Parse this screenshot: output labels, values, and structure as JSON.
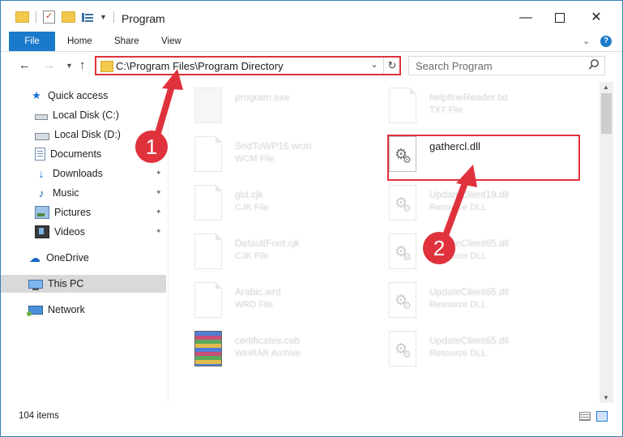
{
  "window": {
    "title": "Program",
    "controls": {
      "minimize": "—",
      "maximize": "",
      "close": "✕"
    }
  },
  "ribbon": {
    "tabs": [
      "File",
      "Home",
      "Share",
      "View"
    ]
  },
  "navigation": {
    "address": "C:\\Program Files\\Program Directory",
    "search_placeholder": "Search Program"
  },
  "nav_pane": {
    "items": [
      {
        "label": "Quick access",
        "icon": "star-icon"
      },
      {
        "label": "Local Disk (C:)",
        "icon": "drive-icon"
      },
      {
        "label": "Local Disk (D:)",
        "icon": "drive-icon"
      },
      {
        "label": "Documents",
        "icon": "documents-icon"
      },
      {
        "label": "Downloads",
        "icon": "download-icon",
        "pinned": true
      },
      {
        "label": "Music",
        "icon": "music-icon",
        "pinned": true
      },
      {
        "label": "Pictures",
        "icon": "pictures-icon",
        "pinned": true
      },
      {
        "label": "Videos",
        "icon": "videos-icon",
        "pinned": true
      },
      {
        "label": "OneDrive",
        "icon": "cloud-icon"
      },
      {
        "label": "This PC",
        "icon": "computer-icon",
        "selected": true
      },
      {
        "label": "Network",
        "icon": "network-icon"
      }
    ]
  },
  "files": {
    "left": [
      {
        "name": "program.exe",
        "type": ""
      },
      {
        "name": "SndToWP16.wcm",
        "type": "WCM File"
      },
      {
        "name": "gtd.cjk",
        "type": "CJK File"
      },
      {
        "name": "DefaultFont.cjk",
        "type": "CJK File"
      },
      {
        "name": "Arabic.wrd",
        "type": "WRD File"
      },
      {
        "name": "certificates.cab",
        "type": "WinRAR Archive"
      }
    ],
    "right": [
      {
        "name": "helpfineReader.txt",
        "type": "TXT File"
      },
      {
        "name": "gathercl.dll",
        "type": ""
      },
      {
        "name": "UpdateClient19.dll",
        "type": "Resource DLL"
      },
      {
        "name": "UpdateClient65.dll",
        "type": "Resource DLL"
      },
      {
        "name": "UpdateClient65.dll",
        "type": "Resource DLL"
      },
      {
        "name": "UpdateClient65.dll",
        "type": "Resource DLL"
      }
    ]
  },
  "status": {
    "item_count": "104 items"
  },
  "annotations": {
    "step1": "1",
    "step2": "2",
    "color": "#e0323d"
  }
}
